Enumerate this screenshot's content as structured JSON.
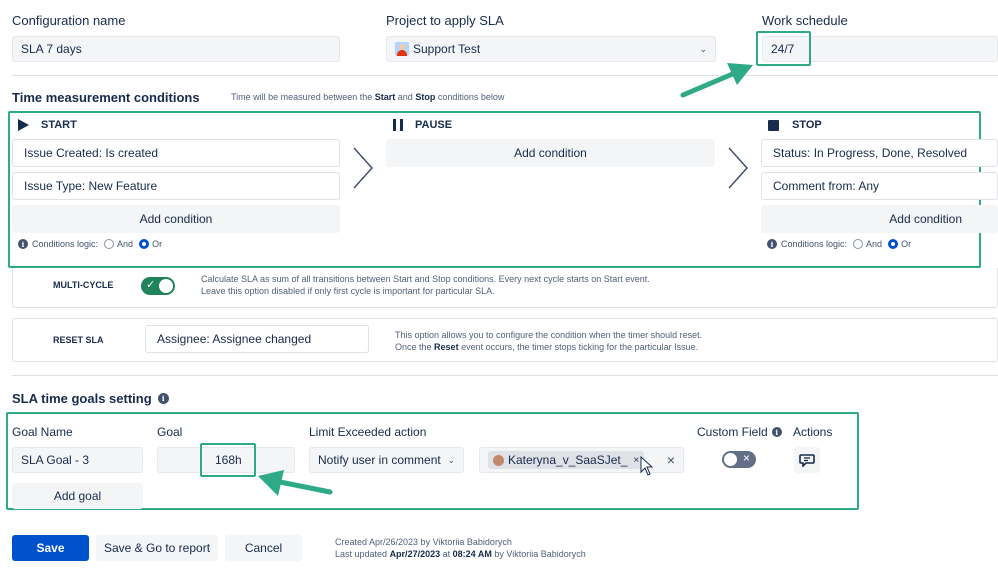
{
  "config": {
    "name_label": "Configuration name",
    "name_value": "SLA 7 days",
    "project_label": "Project to apply SLA",
    "project_value": "Support Test",
    "schedule_label": "Work schedule",
    "schedule_value": "24/7"
  },
  "conditions": {
    "title": "Time measurement conditions",
    "hint_prefix": "Time will be measured between the",
    "hint_start": "Start",
    "hint_and": "and",
    "hint_stop": "Stop",
    "hint_suffix": "conditions below",
    "start": {
      "label": "START",
      "items": [
        "Issue Created: Is created",
        "Issue Type: New Feature"
      ],
      "add_label": "Add condition",
      "logic_label": "Conditions logic:",
      "opt_and": "And",
      "opt_or": "Or",
      "selected": "Or"
    },
    "pause": {
      "label": "PAUSE",
      "add_label": "Add condition"
    },
    "stop": {
      "label": "STOP",
      "items": [
        "Status: In Progress, Done, Resolved",
        "Comment from: Any"
      ],
      "add_label": "Add condition",
      "logic_label": "Conditions logic:",
      "opt_and": "And",
      "opt_or": "Or",
      "selected": "Or"
    }
  },
  "multicycle": {
    "label": "MULTI-CYCLE",
    "enabled": true,
    "desc1": "Calculate SLA as sum of all transitions between Start and Stop conditions. Every next cycle starts on Start event.",
    "desc2": "Leave this option disabled if only first cycle is important for particular SLA."
  },
  "reset": {
    "label": "RESET SLA",
    "value": "Assignee: Assignee changed",
    "desc1": "This option allows you to configure the condition when the timer should reset.",
    "desc2_prefix": "Once the",
    "desc2_bold": "Reset",
    "desc2_suffix": "event occurs, the timer stops ticking for the particular Issue."
  },
  "goals": {
    "title": "SLA time goals setting",
    "col_name": "Goal Name",
    "col_goal": "Goal",
    "col_action": "Limit Exceeded action",
    "col_custom": "Custom Field",
    "col_actions": "Actions",
    "row": {
      "name": "SLA Goal - 3",
      "goal": "168h",
      "action": "Notify user in comment",
      "user": "Kateryna_v_SaaSJet_",
      "custom_field_enabled": false
    },
    "add_label": "Add goal"
  },
  "footer": {
    "save": "Save",
    "save_report": "Save & Go to report",
    "cancel": "Cancel",
    "created_prefix": "Created Apr/26/2023 by Viktoriia Babidorych",
    "updated_prefix": "Last updated",
    "updated_date": "Apr/27/2023",
    "updated_at": "at",
    "updated_time": "08:24 AM",
    "updated_by": "by Viktoriia Babidorych"
  },
  "colors": {
    "accent": "#0052cc",
    "highlight": "#2eaa86",
    "toggle_on": "#1f845a"
  }
}
